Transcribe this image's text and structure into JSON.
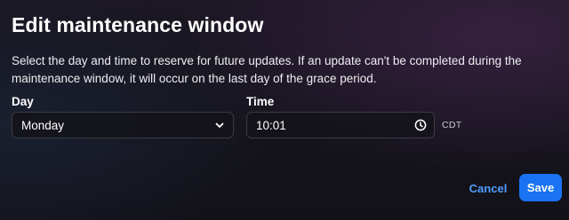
{
  "dialog": {
    "title": "Edit maintenance window",
    "description": "Select the day and time to reserve for future updates. If an update can't be completed during the maintenance window, it will occur on the last day of the grace period.",
    "day": {
      "label": "Day",
      "value": "Monday",
      "icon": "chevron-down-icon"
    },
    "time": {
      "label": "Time",
      "value": "10:01",
      "icon": "clock-icon",
      "timezone": "CDT"
    },
    "cancel_label": "Cancel",
    "save_label": "Save"
  },
  "colors": {
    "accent": "#1a73f2",
    "link": "#4f9dff",
    "background": "#17151e"
  }
}
